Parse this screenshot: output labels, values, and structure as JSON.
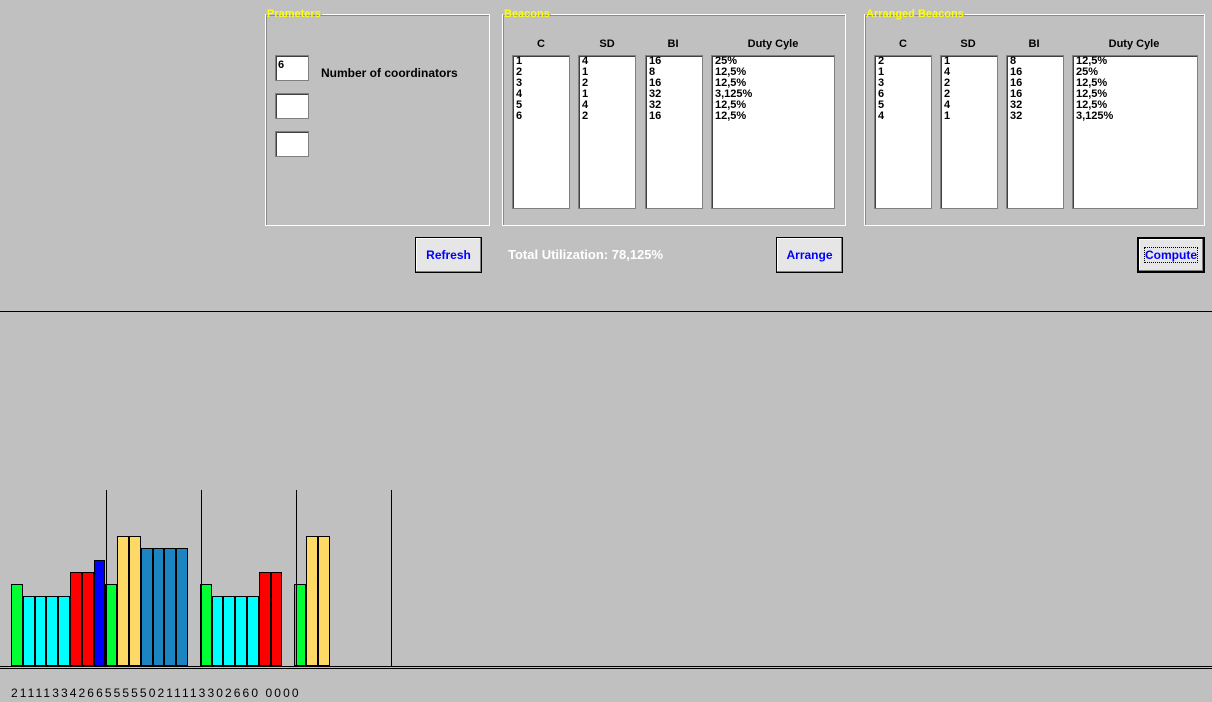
{
  "parameters": {
    "legend": "Prameters",
    "coordinators_value": "6",
    "coordinators_label": "Number of coordinators",
    "field2_value": "",
    "field3_value": ""
  },
  "beacons": {
    "legend": "Beacons",
    "headers": [
      "C",
      "SD",
      "BI",
      "Duty Cyle"
    ],
    "c": [
      "1",
      "2",
      "3",
      "4",
      "5",
      "6"
    ],
    "sd": [
      "4",
      "1",
      "2",
      "1",
      "4",
      "2"
    ],
    "bi": [
      "16",
      "8",
      "16",
      "32",
      "32",
      "16"
    ],
    "duty": [
      "25%",
      "12,5%",
      "12,5%",
      "3,125%",
      "12,5%",
      "12,5%"
    ]
  },
  "arranged": {
    "legend": "Arranged Beacons",
    "headers": [
      "C",
      "SD",
      "BI",
      "Duty Cyle"
    ],
    "c": [
      "2",
      "1",
      "3",
      "6",
      "5",
      "4"
    ],
    "sd": [
      "1",
      "4",
      "2",
      "2",
      "4",
      "1"
    ],
    "bi": [
      "8",
      "16",
      "16",
      "16",
      "32",
      "32"
    ],
    "duty": [
      "12,5%",
      "25%",
      "12,5%",
      "12,5%",
      "12,5%",
      "3,125%"
    ]
  },
  "buttons": {
    "refresh": "Refresh",
    "arrange": "Arrange",
    "compute": "Compute"
  },
  "utilization_text": "Total Utilization: 78,125%",
  "colors": {
    "1": "#ffd966",
    "2": "#00ff00",
    "3": "#ff0000",
    "4": "#0000ff",
    "5": "#1a85c0",
    "6": "#ffd966",
    "1b": "#00ffff"
  },
  "schedule": {
    "slots": [
      2,
      1,
      1,
      1,
      1,
      3,
      3,
      4,
      2,
      6,
      6,
      5,
      5,
      5,
      5,
      0,
      2,
      1,
      1,
      1,
      1,
      3,
      3,
      0,
      2,
      6,
      6,
      0,
      0,
      0,
      0,
      0
    ],
    "sequence_text": "21111334266555550211113302660 0000"
  },
  "chart_data": {
    "type": "bar",
    "categories": [
      "2",
      "1",
      "1",
      "1",
      "1",
      "3",
      "3",
      "4",
      "2",
      "6",
      "6",
      "5",
      "5",
      "5",
      "5",
      "0",
      "2",
      "1",
      "1",
      "1",
      "1",
      "3",
      "3",
      "0",
      "2",
      "6",
      "6",
      "0",
      "0",
      "0",
      "0",
      "0"
    ],
    "values": [
      1,
      2,
      2,
      2,
      2,
      3,
      3,
      4,
      1,
      5,
      5,
      4.5,
      4.5,
      4.5,
      4.5,
      0,
      1,
      2,
      2,
      2,
      2,
      3,
      3,
      0,
      1,
      5,
      5,
      0,
      0,
      0,
      0,
      0
    ]
  }
}
